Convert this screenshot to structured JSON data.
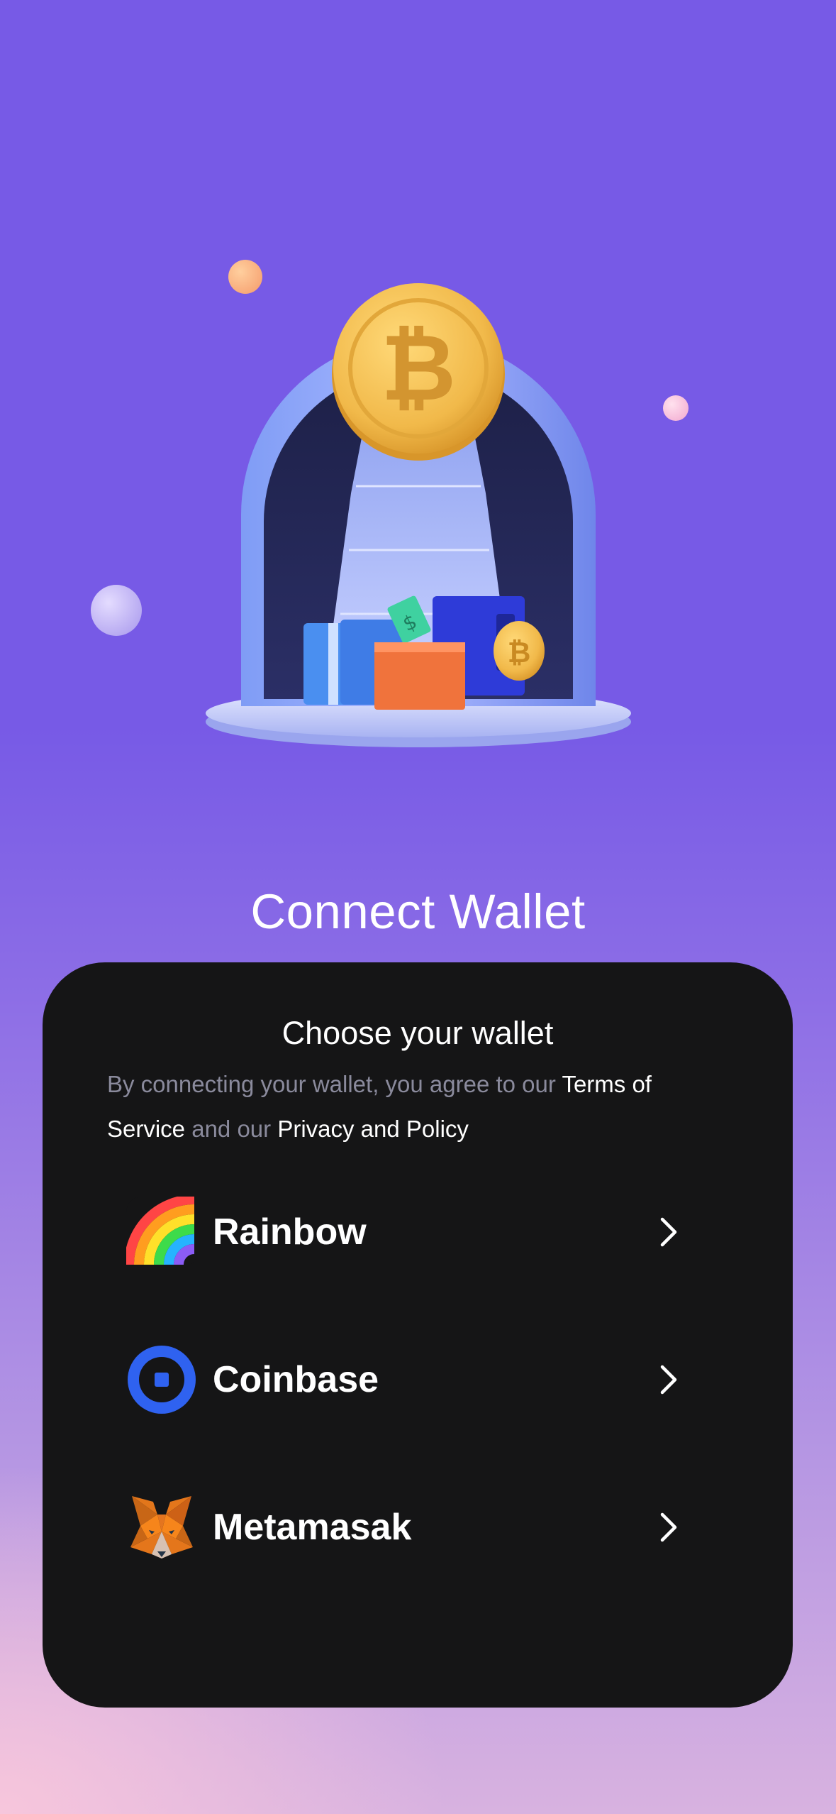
{
  "screen": {
    "title": "Connect Wallet"
  },
  "hero": {
    "illustration_icon": "bitcoin-arch-illustration-icon"
  },
  "sheet": {
    "title": "Choose your wallet",
    "consent": {
      "prefix": "By connecting your wallet, you agree to our",
      "terms_link": "Terms of Service",
      "middle": "and our",
      "privacy_link": "Privacy and Policy"
    },
    "wallets": [
      {
        "label": "Rainbow",
        "icon": "rainbow-icon"
      },
      {
        "label": "Coinbase",
        "icon": "coinbase-icon"
      },
      {
        "label": "Metamasak",
        "icon": "metamask-fox-icon"
      }
    ]
  },
  "colors": {
    "background_top": "#775ae6",
    "background_bottom": "#f7c6dc",
    "sheet": "#151516",
    "muted_text": "#8a8a9c",
    "coinbase_blue": "#2f62f0"
  }
}
